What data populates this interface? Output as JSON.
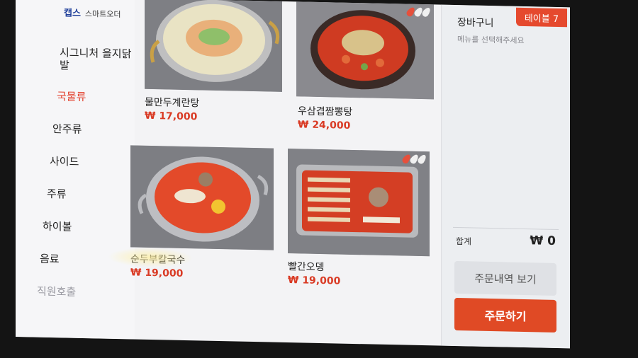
{
  "brand": {
    "logo": "캡스",
    "subtitle": "스마트오더"
  },
  "menu": {
    "items": [
      {
        "label": "시그니처 을지닭발",
        "active": false
      },
      {
        "label": "국물류",
        "active": true
      },
      {
        "label": "안주류",
        "active": false
      },
      {
        "label": "사이드",
        "active": false
      },
      {
        "label": "주류",
        "active": false
      },
      {
        "label": "하이볼",
        "active": false
      },
      {
        "label": "음료",
        "active": false
      }
    ],
    "staff_call": "직원호출"
  },
  "products": [
    {
      "name": "물만두계란탕",
      "price": "₩ 17,000",
      "spicy": false
    },
    {
      "name": "우삼겹짬뽕탕",
      "price": "₩ 24,000",
      "spicy": true
    },
    {
      "name": "순두부칼국수",
      "price": "₩ 19,000",
      "spicy": false
    },
    {
      "name": "빨간오뎅",
      "price": "₩ 19,000",
      "spicy": true
    }
  ],
  "cart": {
    "title": "장바구니",
    "table": "테이블 7",
    "hint": "메뉴를 선택해주세요",
    "total_label": "합계",
    "total_value": "₩ 0",
    "history_button": "주문내역 보기",
    "order_button": "주문하기"
  },
  "colors": {
    "accent": "#e04a25",
    "brand": "#1f3f9a",
    "price": "#d93a24"
  }
}
